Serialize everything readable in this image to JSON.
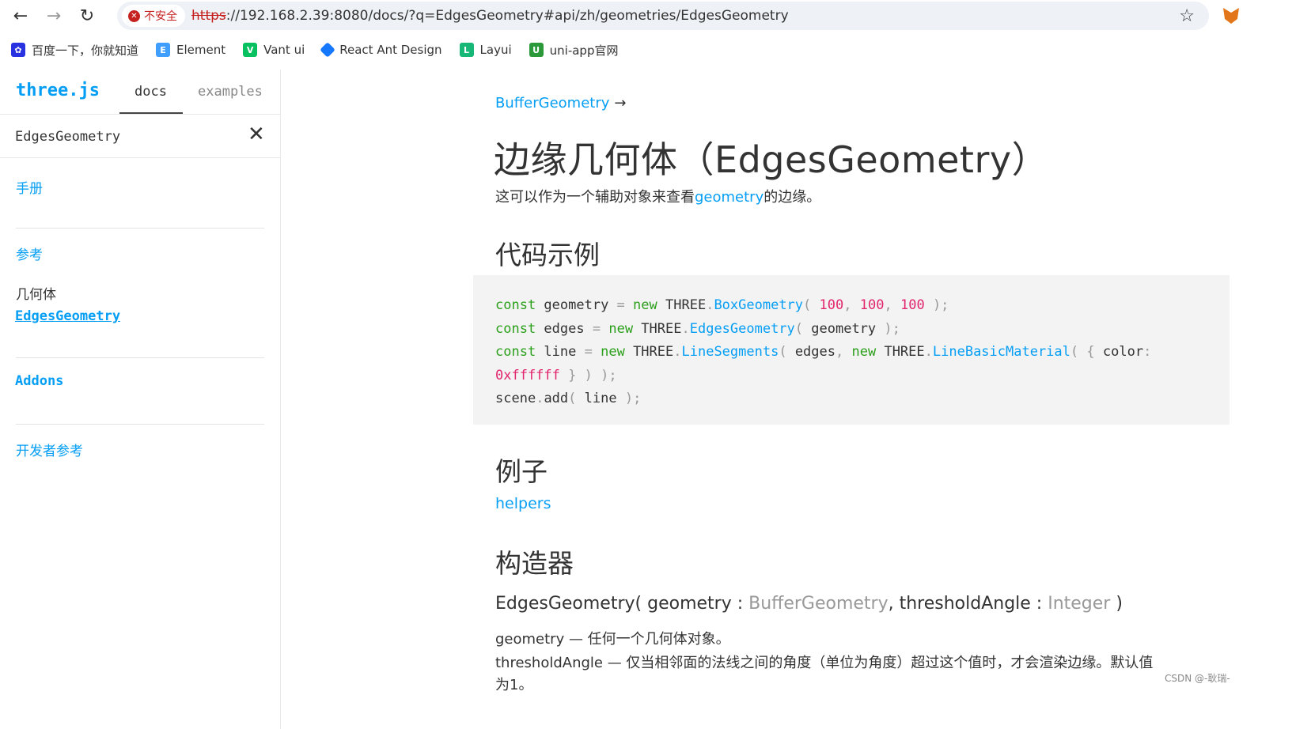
{
  "browser": {
    "security_label": "不安全",
    "url_scheme": "https",
    "url_rest": "://192.168.2.39:8080/docs/?q=EdgesGeometry#api/zh/geometries/EdgesGeometry",
    "bookmarks": [
      {
        "label": "百度一下，你就知道",
        "icon": "baidu-icon",
        "color": "#2932e1"
      },
      {
        "label": "Element",
        "icon": "element-icon",
        "color": "#409eff"
      },
      {
        "label": "Vant ui",
        "icon": "vant-icon",
        "color": "#07c160"
      },
      {
        "label": "React Ant Design",
        "icon": "ant-design-icon",
        "color": "#1677ff"
      },
      {
        "label": "Layui",
        "icon": "layui-icon",
        "color": "#16b777"
      },
      {
        "label": "uni-app官网",
        "icon": "uni-app-icon",
        "color": "#2b9939"
      }
    ]
  },
  "sidebar": {
    "brand": "three.js",
    "tabs": {
      "docs": "docs",
      "examples": "examples"
    },
    "search_value": "EdgesGeometry",
    "sections": {
      "manual": "手册",
      "reference": "参考",
      "group": "几何体",
      "active_link": "EdgesGeometry",
      "addons": "Addons",
      "developer": "开发者参考"
    }
  },
  "main": {
    "parent_link": "BufferGeometry",
    "parent_arrow": "→",
    "title": "边缘几何体（EdgesGeometry）",
    "desc_before": "这可以作为一个辅助对象来查看",
    "desc_link": "geometry",
    "desc_after": "的边缘。",
    "h_code": "代码示例",
    "h_examples": "例子",
    "example_link": "helpers",
    "h_ctor": "构造器",
    "ctor": {
      "name": "EdgesGeometry( geometry : ",
      "type1": "BufferGeometry",
      "mid": ", thresholdAngle : ",
      "type2": "Integer",
      "end": " )"
    },
    "param1": "geometry — 任何一个几何体对象。",
    "param2": "thresholdAngle — 仅当相邻面的法线之间的角度（单位为角度）超过这个值时，才会渲染边缘。默认值",
    "param2_cont": "为1。"
  },
  "watermark": "CSDN @-耿瑞-",
  "colors": {
    "accent": "#049ef4",
    "keyword": "#2ca01c",
    "number": "#e2266d"
  }
}
